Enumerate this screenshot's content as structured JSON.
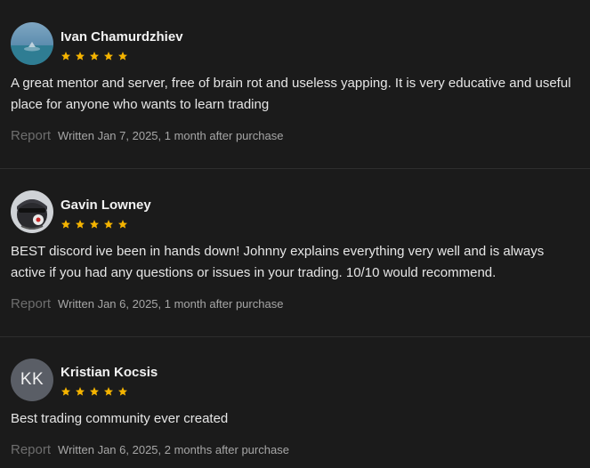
{
  "colors": {
    "background": "#1b1b1b",
    "star": "#f5b400",
    "report": "#6e6e6e",
    "meta": "#a6a6a6",
    "divider": "#2e2e2e"
  },
  "reviews": [
    {
      "name": "Ivan Chamurdzhiev",
      "avatar": "photo-avatar",
      "rating": 5,
      "text": "A great mentor and server, free of brain rot and useless yapping. It is very educative and useful place for anyone who wants to learn trading",
      "report_label": "Report",
      "written": "Written Jan 7, 2025, 1 month after purchase"
    },
    {
      "name": "Gavin Lowney",
      "avatar": "photo-avatar",
      "rating": 5,
      "text": "BEST discord ive been in hands down! Johnny explains everything very well and is always active if you had any questions or issues in your trading. 10/10 would recommend.",
      "report_label": "Report",
      "written": "Written Jan 6, 2025, 1 month after purchase"
    },
    {
      "name": "Kristian Kocsis",
      "avatar_initials": "KK",
      "rating": 5,
      "text": "Best trading community ever created",
      "report_label": "Report",
      "written": "Written Jan 6, 2025, 2 months after purchase"
    }
  ]
}
